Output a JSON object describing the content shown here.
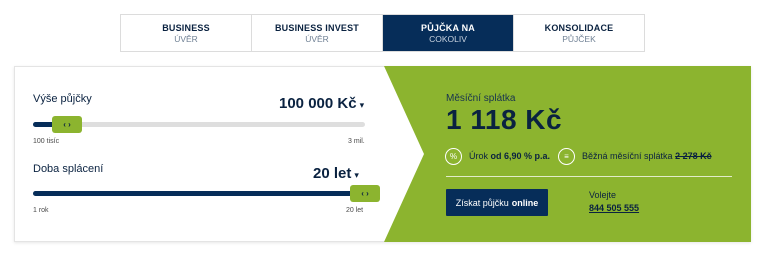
{
  "tabs": [
    {
      "title": "BUSINESS",
      "subtitle": "ÚVĚR"
    },
    {
      "title": "BUSINESS INVEST",
      "subtitle": "ÚVĚR"
    },
    {
      "title": "PŮJČKA NA",
      "subtitle": "COKOLIV"
    },
    {
      "title": "KONSOLIDACE",
      "subtitle": "PŮJČEK"
    }
  ],
  "active_tab_index": 2,
  "amount": {
    "label": "Výše půjčky",
    "value": "100 000 Kč",
    "caret": "▾",
    "min_label": "100 tisíc",
    "max_label": "3 mil.",
    "slider_fraction": 0.0,
    "handle_glyph": "‹ ›"
  },
  "term": {
    "label": "Doba splácení",
    "value": "20 let",
    "caret": "▾",
    "min_label": "1 rok",
    "max_label": "20 let",
    "slider_fraction": 1.0,
    "handle_glyph": "‹ ›"
  },
  "result": {
    "monthly_label": "Měsíční splátka",
    "monthly_value": "1 118 Kč",
    "rate_icon": "%",
    "rate_prefix": "Úrok",
    "rate_value": "od 6,90 % p.a.",
    "compare_icon": "≡",
    "compare_label": "Běžná měsíční splátka",
    "compare_value": "2 278 Kč",
    "cta_text": "Získat půjčku",
    "cta_bold": "online",
    "call_label": "Volejte",
    "phone": "844 505 555"
  },
  "colors": {
    "navy": "#062d59",
    "green": "#8cb42f",
    "track": "#dedede"
  }
}
